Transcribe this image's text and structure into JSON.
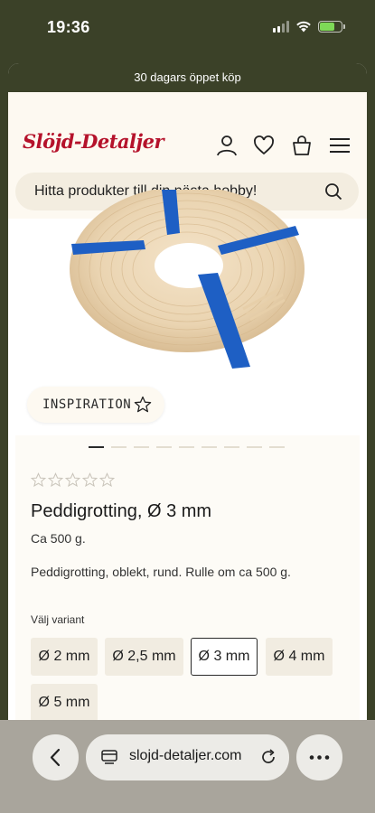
{
  "status": {
    "time": "19:36"
  },
  "banner": {
    "text": "30 dagars öppet köp"
  },
  "header": {
    "logo": "Slöjd-Detaljer"
  },
  "search": {
    "placeholder": "Hitta produkter till din nästa hobby!"
  },
  "hero": {
    "tag": "INSPIRATION"
  },
  "product": {
    "rating": 0,
    "title": "Peddigrotting, Ø 3 mm",
    "subtitle": "Ca 500 g.",
    "description": "Peddigrotting, oblekt, rund. Rulle om ca 500 g.",
    "variant_label": "Välj variant",
    "variants": [
      "Ø 2 mm",
      "Ø 2,5 mm",
      "Ø 3 mm",
      "Ø 4 mm",
      "Ø 5 mm"
    ],
    "selected_variant": "Ø 3 mm"
  },
  "carousel": {
    "count": 9,
    "active": 0
  },
  "browser": {
    "url": "slojd-detaljer.com"
  },
  "colors": {
    "brand": "#b5122b",
    "dark": "#3b4128",
    "cream": "#fdf9f1"
  }
}
